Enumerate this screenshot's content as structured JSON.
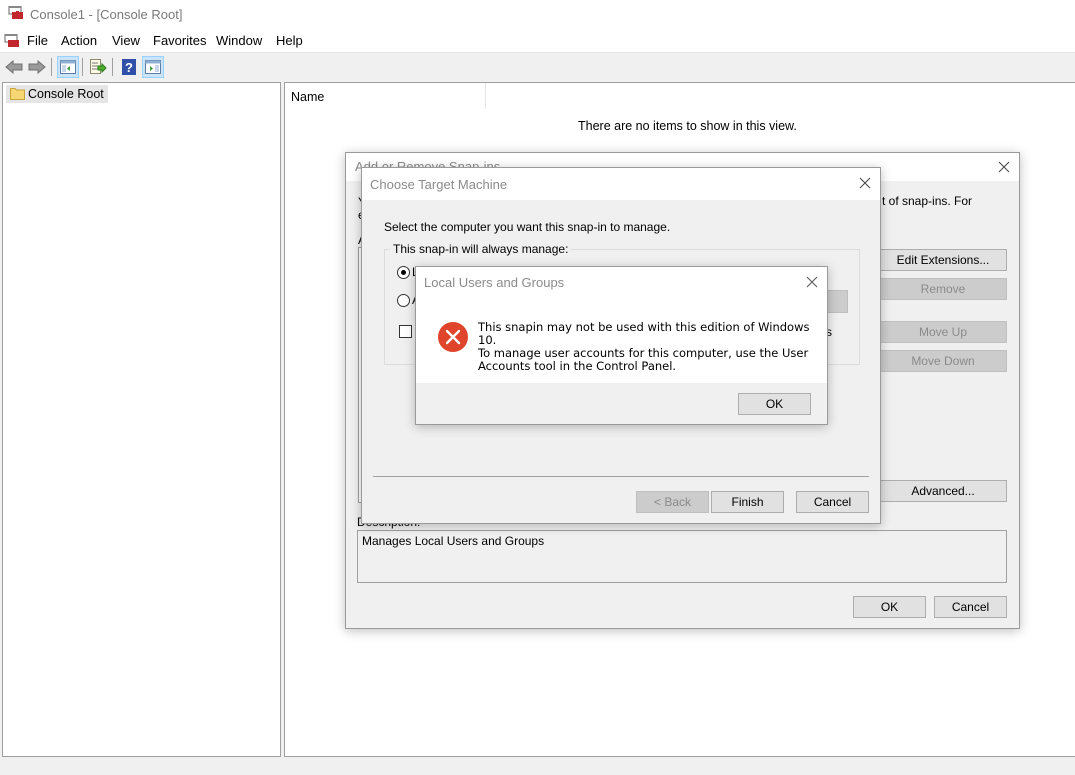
{
  "window": {
    "title": "Console1 - [Console Root]"
  },
  "menu": {
    "items": [
      "File",
      "Action",
      "View",
      "Favorites",
      "Window",
      "Help"
    ]
  },
  "toolbar": {
    "buttons": [
      {
        "icon": "back-arrow-icon"
      },
      {
        "icon": "forward-arrow-icon"
      },
      {
        "icon": "show-hide-console-tree-icon",
        "active": true
      },
      {
        "icon": "export-list-icon"
      },
      {
        "icon": "help-icon"
      },
      {
        "icon": "show-hide-action-pane-icon",
        "active": true
      }
    ]
  },
  "tree": {
    "items": [
      {
        "label": "Console Root",
        "icon": "folder-icon",
        "selected": true
      }
    ]
  },
  "list": {
    "columns": [
      "Name"
    ],
    "empty_message": "There are no items to show in this view."
  },
  "add_remove_dialog": {
    "title": "Add or Remove Snap-ins",
    "intro_fragment_right": "t of snap-ins. For",
    "intro_fragment_left_1": "Y",
    "intro_fragment_left_2": "e",
    "available_label_fragment": "A",
    "buttons": {
      "edit_extensions": "Edit Extensions...",
      "remove": "Remove",
      "move_up": "Move Up",
      "move_down": "Move Down",
      "advanced": "Advanced...",
      "ok": "OK",
      "cancel": "Cancel"
    },
    "description_label": "Description:",
    "description_text": "Manages Local Users and Groups"
  },
  "target_dialog": {
    "title": "Choose Target Machine",
    "prompt": "Select the computer you want this snap-in to manage.",
    "group_label": "This snap-in will always manage:",
    "radio_local_fragment": "L",
    "radio_another_fragment": "A",
    "checkbox_fragment_right": "s",
    "buttons": {
      "back": "< Back",
      "finish": "Finish",
      "cancel": "Cancel"
    }
  },
  "error_dialog": {
    "title": "Local Users and Groups",
    "message_lines": [
      "This snapin may not be used with this edition of Windows 10.",
      "To manage user accounts for this computer, use the User",
      "Accounts tool in the Control Panel."
    ],
    "ok_label": "OK",
    "icon": "error-icon",
    "icon_color": "#e0442a"
  }
}
